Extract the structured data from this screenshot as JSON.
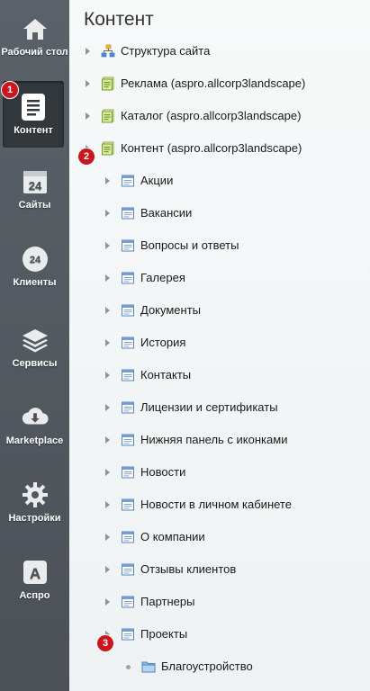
{
  "sidebar": {
    "items": [
      {
        "label": "Рабочий стол",
        "icon": "home-icon"
      },
      {
        "label": "Контент",
        "icon": "document-icon"
      },
      {
        "label": "Сайты",
        "icon": "calendar-24-icon"
      },
      {
        "label": "Клиенты",
        "icon": "cloud-24-icon"
      },
      {
        "label": "Сервисы",
        "icon": "layers-icon"
      },
      {
        "label": "Marketplace",
        "icon": "cloud-download-icon"
      },
      {
        "label": "Настройки",
        "icon": "gear-icon"
      },
      {
        "label": "Аспро",
        "icon": "letter-a-icon"
      }
    ]
  },
  "badges": [
    "1",
    "2",
    "3"
  ],
  "main": {
    "title": "Контент",
    "tree": [
      {
        "label": "Структура сайта",
        "icon": "site-structure-icon"
      },
      {
        "label": "Реклама (aspro.allcorp3landscape)",
        "icon": "iblock-type-icon"
      },
      {
        "label": "Каталог (aspro.allcorp3landscape)",
        "icon": "iblock-type-icon"
      },
      {
        "label": "Контент (aspro.allcorp3landscape)",
        "icon": "iblock-type-icon"
      },
      {
        "label": "Акции",
        "icon": "iblock-icon"
      },
      {
        "label": "Вакансии",
        "icon": "iblock-icon"
      },
      {
        "label": "Вопросы и ответы",
        "icon": "iblock-icon"
      },
      {
        "label": "Галерея",
        "icon": "iblock-icon"
      },
      {
        "label": "Документы",
        "icon": "iblock-icon"
      },
      {
        "label": "История",
        "icon": "iblock-icon"
      },
      {
        "label": "Контакты",
        "icon": "iblock-icon"
      },
      {
        "label": "Лицензии и сертификаты",
        "icon": "iblock-icon"
      },
      {
        "label": "Нижняя панель с иконками",
        "icon": "iblock-icon"
      },
      {
        "label": "Новости",
        "icon": "iblock-icon"
      },
      {
        "label": "Новости в личном кабинете",
        "icon": "iblock-icon"
      },
      {
        "label": "О компании",
        "icon": "iblock-icon"
      },
      {
        "label": "Отзывы клиентов",
        "icon": "iblock-icon"
      },
      {
        "label": "Партнеры",
        "icon": "iblock-icon"
      },
      {
        "label": "Проекты",
        "icon": "iblock-icon"
      },
      {
        "label": "Благоустройство",
        "icon": "folder-icon"
      }
    ]
  },
  "colors": {
    "sidebar": "#555b61",
    "badge": "#c8171e",
    "accent": "#2a7fcf"
  }
}
